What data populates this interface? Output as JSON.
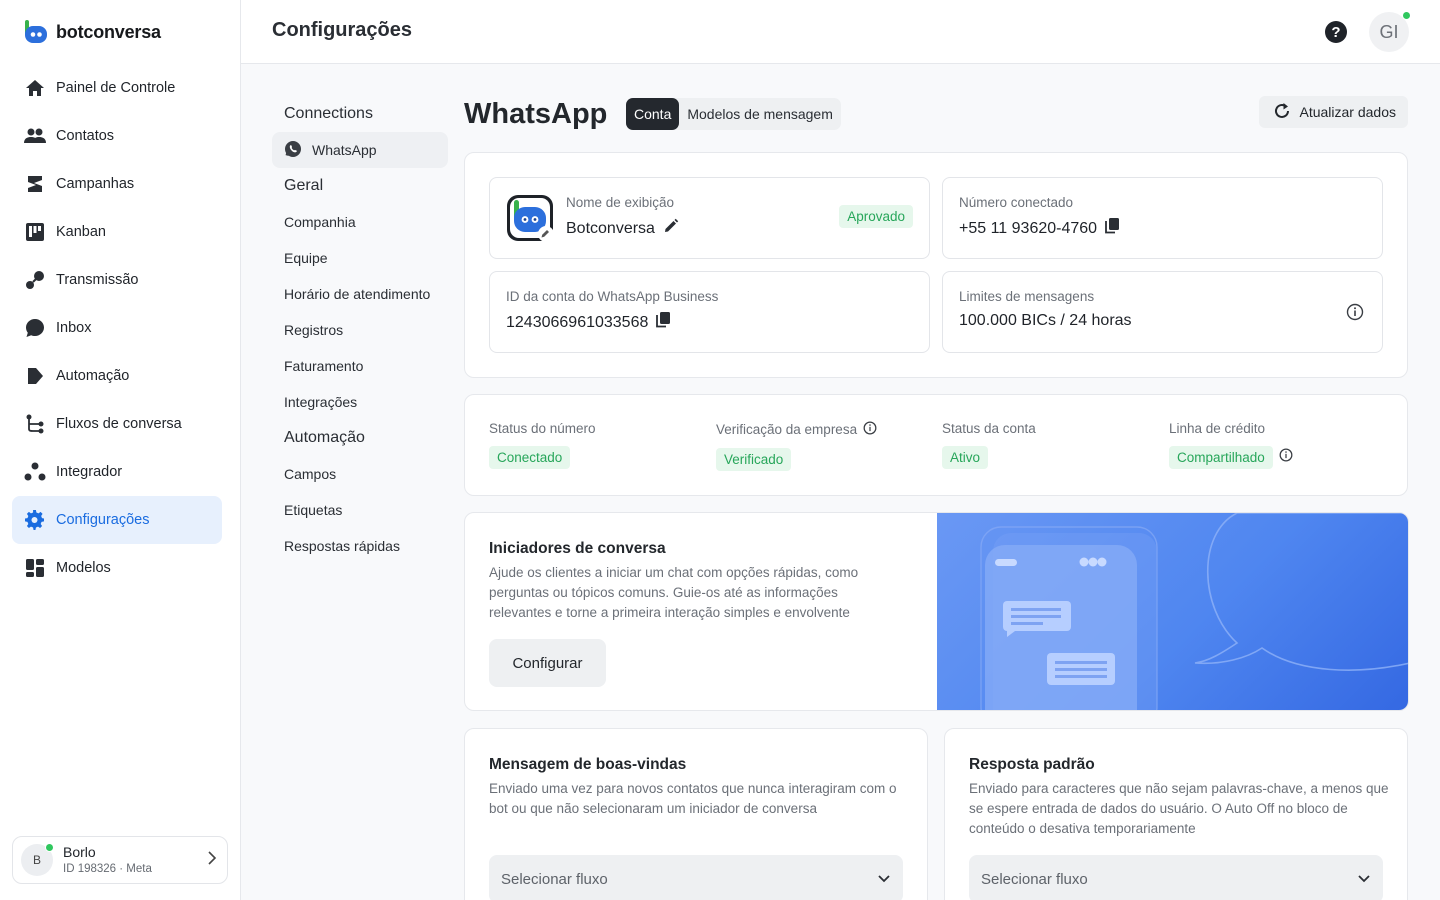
{
  "brand": {
    "name": "botconversa"
  },
  "header": {
    "title": "Configurações",
    "help_icon": "question-circle-icon",
    "user_initials": "GI"
  },
  "sidebar": {
    "items": [
      {
        "label": "Painel de Controle",
        "icon": "home-icon"
      },
      {
        "label": "Contatos",
        "icon": "users-icon"
      },
      {
        "label": "Campanhas",
        "icon": "campaign-icon"
      },
      {
        "label": "Kanban",
        "icon": "kanban-icon"
      },
      {
        "label": "Transmissão",
        "icon": "broadcast-icon"
      },
      {
        "label": "Inbox",
        "icon": "chat-icon"
      },
      {
        "label": "Automação",
        "icon": "automation-icon"
      },
      {
        "label": "Fluxos de conversa",
        "icon": "flow-icon"
      },
      {
        "label": "Integrador",
        "icon": "integrator-icon"
      },
      {
        "label": "Configurações",
        "icon": "gear-icon",
        "active": true
      },
      {
        "label": "Modelos",
        "icon": "templates-icon"
      }
    ],
    "account": {
      "initial": "B",
      "name": "Borlo",
      "sub": "ID 198326 · Meta"
    }
  },
  "settings_nav": {
    "connections_heading": "Connections",
    "connections_items": [
      "WhatsApp"
    ],
    "geral_heading": "Geral",
    "geral_items": [
      "Companhia",
      "Equipe",
      "Horário de atendimento",
      "Registros",
      "Faturamento",
      "Integrações"
    ],
    "automacao_heading": "Automação",
    "automacao_items": [
      "Campos",
      "Etiquetas",
      "Respostas rápidas"
    ]
  },
  "main": {
    "title": "WhatsApp",
    "tabs": [
      "Conta",
      "Modelos de mensagem"
    ],
    "refresh_label": "Atualizar dados",
    "profile": {
      "display_name_label": "Nome de exibição",
      "display_name": "Botconversa",
      "status": "Aprovado",
      "number_label": "Número conectado",
      "number": "+55 11 93620-4760",
      "waba_label": "ID da conta do WhatsApp Business",
      "waba_id": "1243066961033568",
      "limits_label": "Limites de mensagens",
      "limits": "100.000 BICs / 24 horas"
    },
    "statuses": [
      {
        "label": "Status do número",
        "value": "Conectado"
      },
      {
        "label": "Verificação da empresa",
        "value": "Verificado"
      },
      {
        "label": "Status da conta",
        "value": "Ativo"
      },
      {
        "label": "Linha de crédito",
        "value": "Compartilhado"
      }
    ],
    "starters": {
      "title": "Iniciadores de conversa",
      "description": "Ajude os clientes a iniciar um chat com opções rápidas, como perguntas ou tópicos comuns. Guie-os até as informações relevantes e torne a primeira interação simples e envolvente",
      "button": "Configurar"
    },
    "welcome": {
      "title": "Mensagem de boas-vindas",
      "description": "Enviado uma vez para novos contatos que nunca interagiram com o bot ou que não selecionaram um iniciador de conversa",
      "select_placeholder": "Selecionar fluxo"
    },
    "default_reply": {
      "title": "Resposta padrão",
      "description": "Enviado para caracteres que não sejam palavras-chave, a menos que se espere entrada de dados do usuário. O Auto Off no bloco de conteúdo o desativa temporariamente",
      "select_placeholder": "Selecionar fluxo"
    }
  },
  "colors": {
    "accent": "#1a6ce0",
    "success": "#27a65a",
    "banner": "#4f86f0"
  }
}
